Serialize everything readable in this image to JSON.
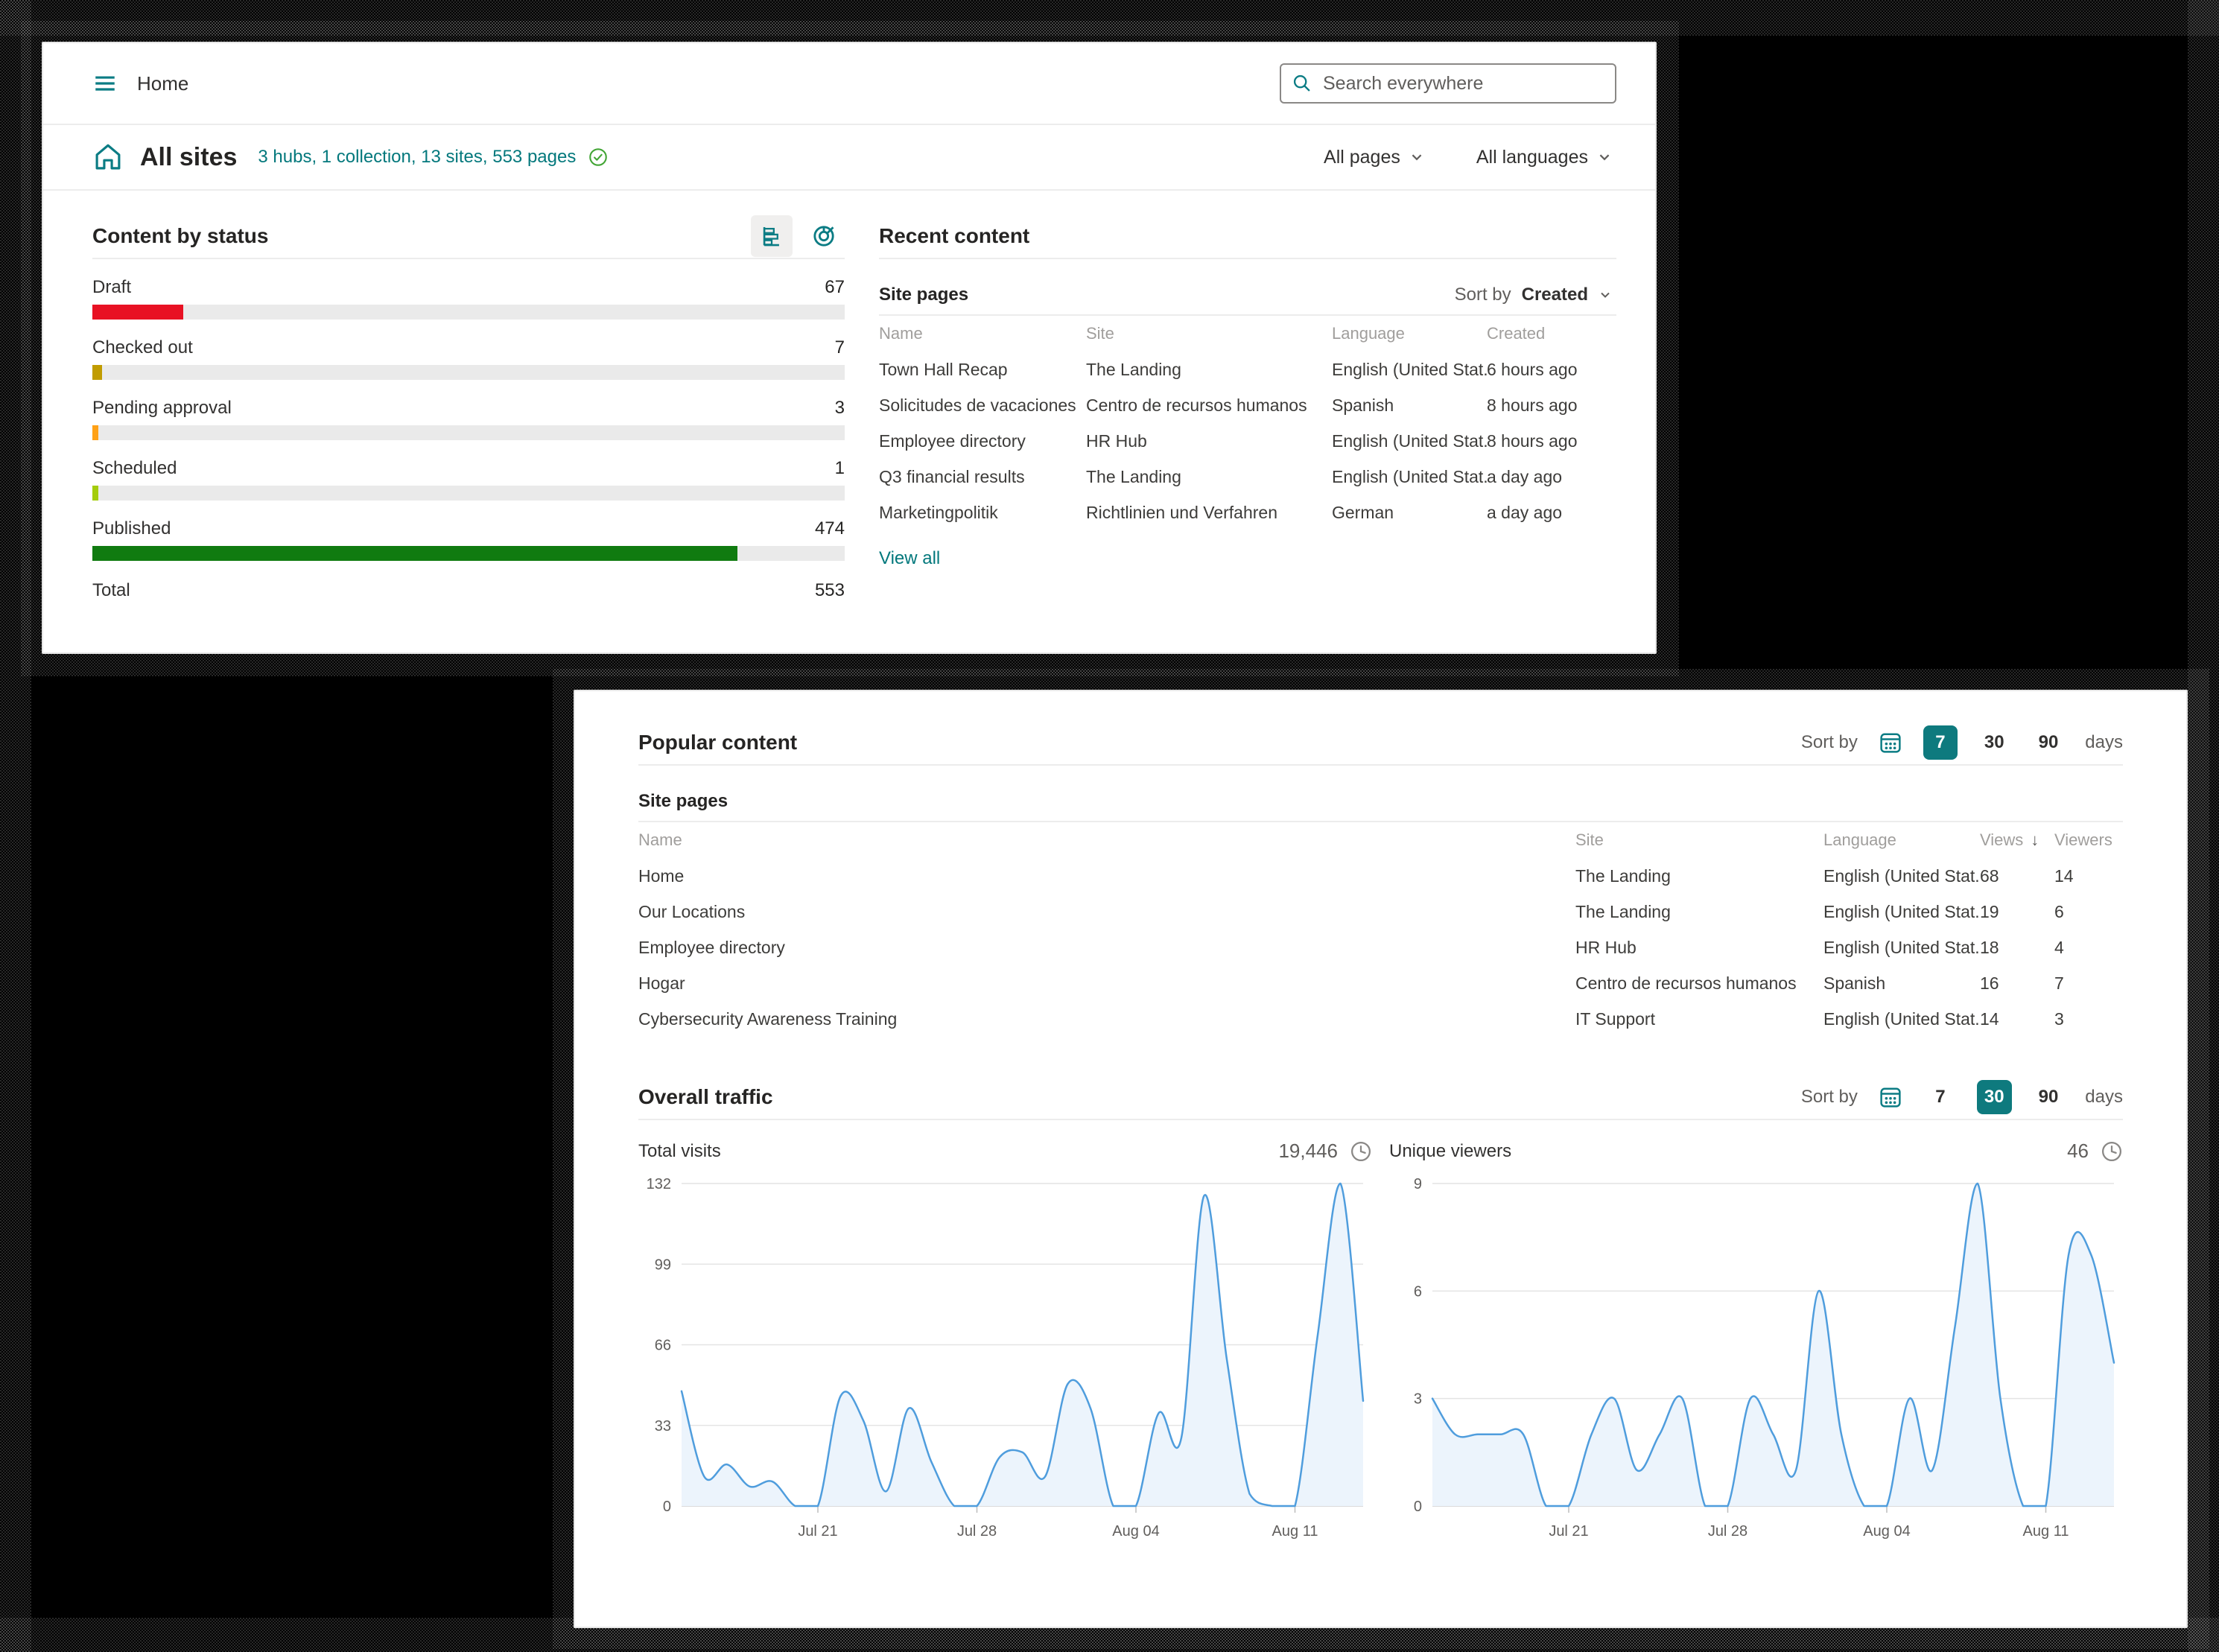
{
  "colors": {
    "accent_teal": "#0b7c84",
    "link_teal": "#03787c",
    "chip_teal": "#0e7a7e",
    "check_green": "#42a535",
    "chart_line": "#4f9ddd",
    "chart_fill": "#ecf4fc"
  },
  "header": {
    "breadcrumb": "Home",
    "search_placeholder": "Search everywhere"
  },
  "site_header": {
    "title": "All sites",
    "summary_link": "3 hubs, 1 collection, 13 sites, 553 pages",
    "page_filter": "All pages",
    "language_filter": "All languages"
  },
  "content_by_status": {
    "title": "Content by status",
    "total_label": "Total",
    "total_value": "553",
    "total": 553,
    "rows": [
      {
        "label": "Draft",
        "value": 67,
        "color": "#e81123"
      },
      {
        "label": "Checked out",
        "value": 7,
        "color": "#c19c00"
      },
      {
        "label": "Pending approval",
        "value": 3,
        "color": "#ffa116"
      },
      {
        "label": "Scheduled",
        "value": 1,
        "color": "#a4cc0c"
      },
      {
        "label": "Published",
        "value": 474,
        "color": "#107b10"
      }
    ]
  },
  "recent_content": {
    "title": "Recent content",
    "group_label": "Site pages",
    "sort_label": "Sort by",
    "sort_value": "Created",
    "columns": [
      "Name",
      "Site",
      "Language",
      "Created"
    ],
    "rows": [
      [
        "Town Hall Recap",
        "The Landing",
        "English (United Stat...",
        "6 hours ago"
      ],
      [
        "Solicitudes de vacaciones",
        "Centro de recursos humanos",
        "Spanish",
        "8 hours ago"
      ],
      [
        "Employee directory",
        "HR Hub",
        "English (United Stat...",
        "8 hours ago"
      ],
      [
        "Q3 financial results",
        "The Landing",
        "English (United Stat...",
        "a day ago"
      ],
      [
        "Marketingpolitik",
        "Richtlinien und Verfahren",
        "German",
        "a day ago"
      ]
    ],
    "view_all": "View all"
  },
  "popular_content": {
    "title": "Popular content",
    "group_label": "Site pages",
    "daypicker": {
      "label": "Sort by",
      "options": [
        "7",
        "30",
        "90"
      ],
      "selected": "7",
      "suffix": "days"
    },
    "columns": [
      "Name",
      "Site",
      "Language",
      "Views",
      "Viewers"
    ],
    "sorted_column": "Views",
    "rows": [
      [
        "Home",
        "The Landing",
        "English (United Stat...",
        "68",
        "14"
      ],
      [
        "Our Locations",
        "The Landing",
        "English (United Stat...",
        "19",
        "6"
      ],
      [
        "Employee directory",
        "HR Hub",
        "English (United Stat...",
        "18",
        "4"
      ],
      [
        "Hogar",
        "Centro de recursos humanos",
        "Spanish",
        "16",
        "7"
      ],
      [
        "Cybersecurity Awareness Training",
        "IT Support",
        "English (United Stat...",
        "14",
        "3"
      ]
    ]
  },
  "overall_traffic": {
    "title": "Overall traffic",
    "daypicker": {
      "label": "Sort by",
      "options": [
        "7",
        "30",
        "90"
      ],
      "selected": "30",
      "suffix": "days"
    }
  },
  "chart_data": [
    {
      "type": "area",
      "title": "Total visits",
      "total": "19,446",
      "x_range": [
        "Jul 15",
        "Aug 14"
      ],
      "values": [
        47,
        12,
        17,
        8,
        10,
        0,
        0,
        45,
        35,
        6,
        40,
        18,
        0,
        0,
        20,
        22,
        12,
        50,
        40,
        0,
        0,
        38,
        28,
        127,
        60,
        5,
        0,
        0,
        70,
        132,
        43
      ],
      "yticks": [
        0,
        33,
        66,
        99,
        132
      ],
      "ylim": [
        0,
        132
      ],
      "xticks": [
        {
          "i": 6,
          "label": "Jul 21"
        },
        {
          "i": 13,
          "label": "Jul 28"
        },
        {
          "i": 20,
          "label": "Aug 04"
        },
        {
          "i": 27,
          "label": "Aug 11"
        }
      ],
      "grid": true,
      "legend": "none"
    },
    {
      "type": "area",
      "title": "Unique viewers",
      "total": "46",
      "x_range": [
        "Jul 15",
        "Aug 14"
      ],
      "values": [
        3,
        2,
        2,
        2,
        2,
        0,
        0,
        2,
        3,
        1,
        2,
        3,
        0,
        0,
        3,
        2,
        1,
        6,
        2,
        0,
        0,
        3,
        1,
        5,
        9,
        3,
        0,
        0,
        7,
        7,
        4
      ],
      "yticks": [
        0,
        3,
        6,
        9
      ],
      "ylim": [
        0,
        9
      ],
      "xticks": [
        {
          "i": 6,
          "label": "Jul 21"
        },
        {
          "i": 13,
          "label": "Jul 28"
        },
        {
          "i": 20,
          "label": "Aug 04"
        },
        {
          "i": 27,
          "label": "Aug 11"
        }
      ],
      "grid": true,
      "legend": "none"
    }
  ]
}
